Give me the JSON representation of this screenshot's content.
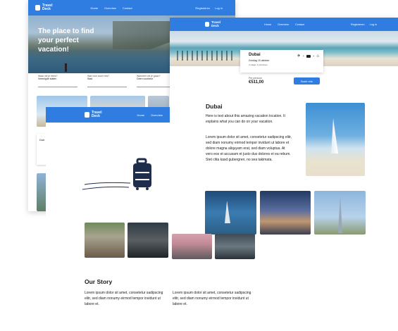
{
  "brand": {
    "line1": "Travel",
    "line2": "Deck"
  },
  "nav": {
    "home": "Home",
    "overview": "Overview",
    "contact": "Contact",
    "register": "Registreren",
    "login": "Log in"
  },
  "home": {
    "hero_title_1": "The place to find",
    "hero_title_2": "your perfect",
    "hero_title_3": "vacation!",
    "search": [
      {
        "label": "Waar wil je heen?",
        "value": "Verenigde staten"
      },
      {
        "label": "Wat voor soort reis?",
        "value": "Stad"
      },
      {
        "label": "Wanneer wil je gaan?",
        "value": "Geen voorkeur"
      }
    ],
    "card_title": "Dub"
  },
  "detail": {
    "city": "Dubai",
    "date": "Zondag 15 oktober",
    "people": "4 volgw. 2 personen",
    "price_label": "Per persoon",
    "price": "€511,00",
    "book_btn": "Boek reis",
    "heading": "Dubai",
    "intro": "Here is text about this amazing vacation location. It explains what you can do on your vacation.",
    "lorem": "Lorem ipsum dolor sit amet, consetetur sadipscing elitr, sed diam nonumy eirmod tempor invidunt ut labore et dolore magna aliquyam erat, sed diam voluptua. At vero eos et accusam et justo duo dolores et ea rebum. Stet clita kasd gubergren, no sea takimata."
  },
  "about": {
    "heading": "Our Story",
    "col1": "Lorem ipsum dolor sit amet, consetetur sadipscing elitr, sed diam nonumy eirmod tempor invidunt ut labore et.",
    "col2": "Lorem ipsum dolor sit amet, consetetur sadipscing elitr, sed diam nonumy eirmod tempor invidunt ut labore et."
  },
  "colors": {
    "brand_blue": "#2f7de1",
    "navy": "#1f2d4d"
  }
}
